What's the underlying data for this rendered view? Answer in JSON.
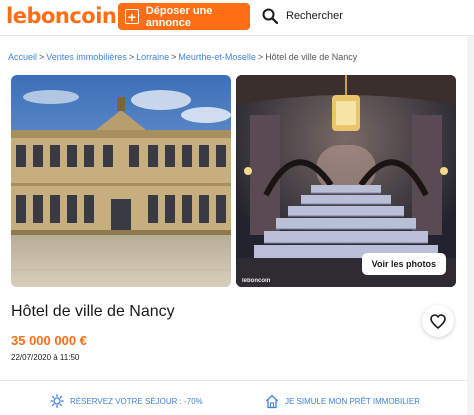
{
  "header": {
    "logo": "leboncoin",
    "post_label": "Déposer une annonce",
    "search_label": "Rechercher"
  },
  "breadcrumb": {
    "items": [
      "Accueil",
      "Ventes immobilières",
      "Lorraine",
      "Meurthe-et-Moselle"
    ],
    "current": "Hôtel de ville de Nancy"
  },
  "gallery": {
    "see_photos_label": "Voir les photos",
    "watermark": "leboncoin"
  },
  "listing": {
    "title": "Hôtel de ville de Nancy",
    "price": "35 000 000 €",
    "date": "22/07/2020 à 11:50"
  },
  "promos": {
    "left": "RÉSERVEZ VOTRE SÉJOUR : -70%",
    "right": "JE SIMULE MON PRÊT IMMOBILIER"
  },
  "colors": {
    "brand": "#ff6e14",
    "link": "#4183d7"
  },
  "icons": [
    "plus-icon",
    "search-icon",
    "heart-icon",
    "sun-icon",
    "house-icon"
  ]
}
